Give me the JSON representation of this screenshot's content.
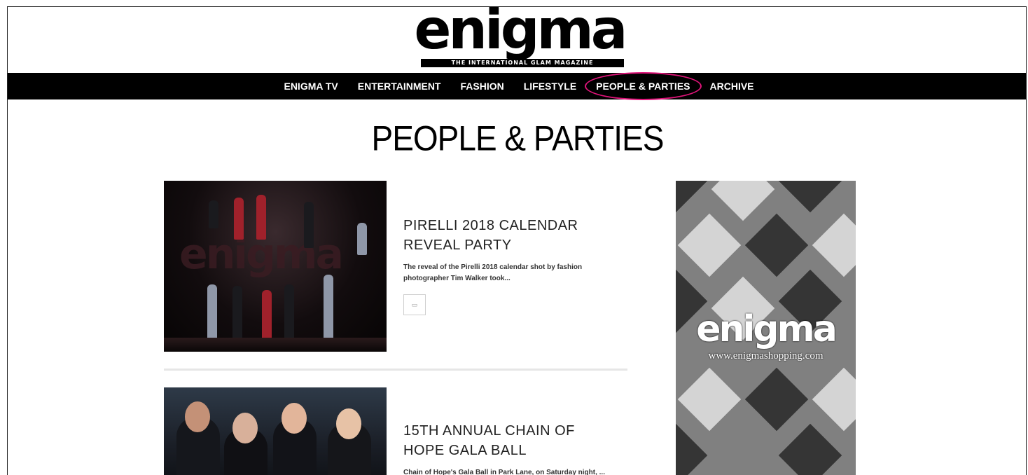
{
  "logo": {
    "wordmark": "enigma",
    "tagline": "THE INTERNATIONAL GLAM MAGAZINE"
  },
  "nav": {
    "items": [
      {
        "label": "ENIGMA TV"
      },
      {
        "label": "ENTERTAINMENT"
      },
      {
        "label": "FASHION"
      },
      {
        "label": "LIFESTYLE"
      },
      {
        "label": "PEOPLE & PARTIES"
      },
      {
        "label": "ARCHIVE"
      }
    ],
    "active": "PEOPLE & PARTIES"
  },
  "page": {
    "title": "PEOPLE & PARTIES"
  },
  "articles": [
    {
      "title": "PIRELLI 2018 CALENDAR REVEAL PARTY",
      "excerpt": "The reveal of the Pirelli 2018 calendar shot by fashion photographer Tim Walker took...",
      "comment_icon": "comment-icon",
      "stage_word": "enigma"
    },
    {
      "title": "15TH ANNUAL CHAIN OF HOPE GALA BALL",
      "excerpt": "Chain of Hope's Gala Ball in Park Lane, on Saturday night, ..."
    }
  ],
  "ad": {
    "wordmark": "enigma",
    "url": "www.enigmashopping.com"
  },
  "colors": {
    "nav_bg": "#000000",
    "highlight": "#e0147a",
    "divider": "#e6e6e6"
  }
}
